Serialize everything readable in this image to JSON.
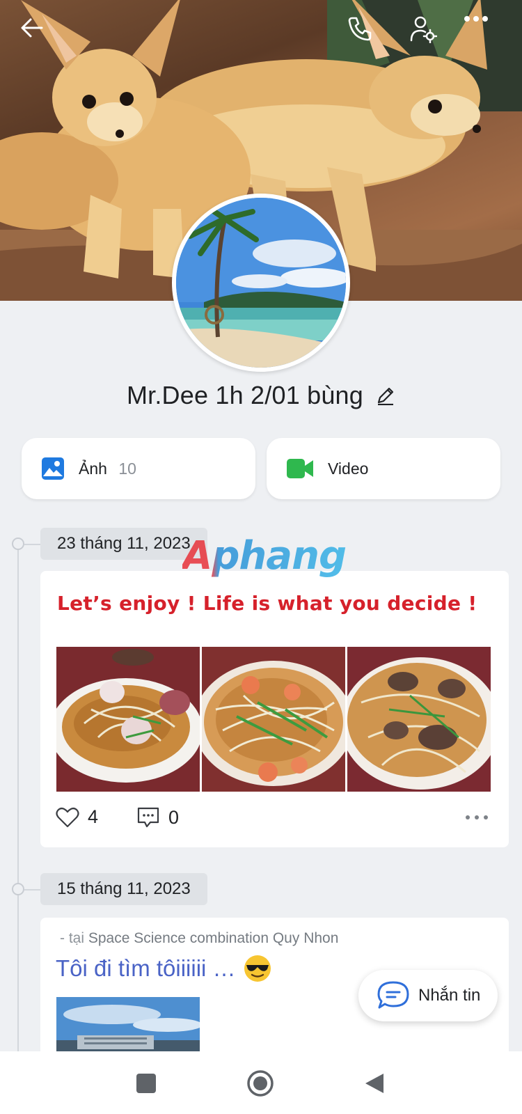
{
  "header": {
    "back_icon": "arrow-left-icon",
    "call_icon": "phone-icon",
    "settings_icon": "user-settings-icon",
    "more_icon": "more-horizontal-icon"
  },
  "profile": {
    "name": "Mr.Dee 1h 2/01 bùng",
    "edit_icon": "pencil-icon"
  },
  "media": {
    "photos": {
      "label": "Ảnh",
      "count": "10",
      "icon": "image-icon",
      "color": "#1f7ae0"
    },
    "videos": {
      "label": "Video",
      "icon": "video-camera-icon",
      "color": "#2fb84e"
    }
  },
  "watermark": "Aphang",
  "posts": [
    {
      "date": "23 tháng 11, 2023",
      "text": "Let’s enjoy ! Life is what you decide !",
      "text_color": "#d6212b",
      "likes": "4",
      "comments": "0"
    },
    {
      "date": "15 tháng 11, 2023",
      "location_prefix": "- tại",
      "location": "Space Science combination Quy Nhon",
      "title": "Tôi đi tìm tôiiiiii …",
      "emoji": "😎"
    }
  ],
  "message_button": {
    "label": "Nhắn tin",
    "icon": "chat-bubble-icon"
  },
  "navbar": {
    "recent_icon": "square-icon",
    "home_icon": "circle-home-icon",
    "back_icon": "triangle-back-icon"
  }
}
